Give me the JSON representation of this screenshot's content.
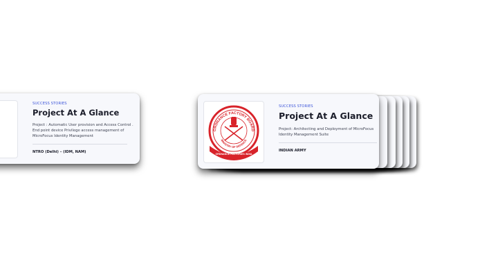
{
  "cards": [
    {
      "eyebrow": "SUCCESS STORIES",
      "title": "Project At A Glance",
      "description": "Project : Automatic User provision and Access Control . End point device Privilege access management of MicroFocus Identity Management",
      "client": "NTRO (Delhi) – (IDM, NAM)",
      "logo": "emblem-seal-icon"
    },
    {
      "eyebrow": "SUCCESS STORIES",
      "title": "Project At A Glance",
      "description": "Project: Architecting and Deployment of MicroFocus Identity Management Suite",
      "client": "INDIAN ARMY",
      "logo": "ordnance-factory-board-seal-icon",
      "logo_text": {
        "top_arc": "ORDNANCE FACTORY BOARD",
        "bottom_arc": "MINISTRY OF DEFENCE",
        "banner": "ORDNANCE FACTORIES INDIA",
        "stars": "★★★★★"
      }
    }
  ],
  "colors": {
    "accent": "#3e56d9",
    "seal_red": "#d8232a",
    "card_bg": "#f7f8fc",
    "title": "#1b1d2a"
  }
}
